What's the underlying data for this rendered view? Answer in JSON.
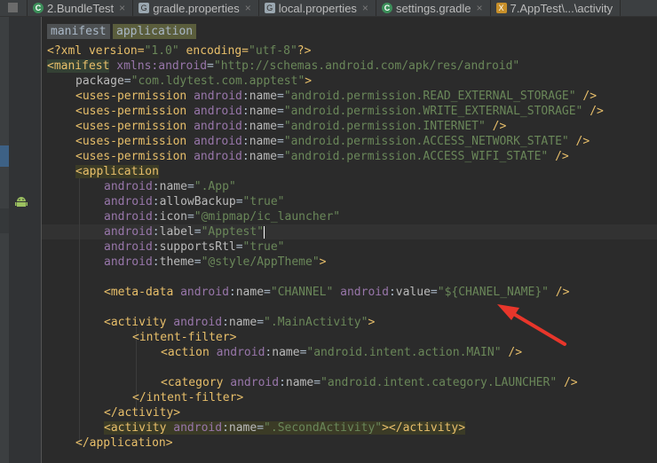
{
  "tabs": [
    {
      "icon": "c-icon",
      "glyph": "C",
      "label": "2.BundleTest",
      "close": "×"
    },
    {
      "icon": "gradle-icon",
      "glyph": "G",
      "label": "gradle.properties",
      "close": "×"
    },
    {
      "icon": "gradle-icon",
      "glyph": "G",
      "label": "local.properties",
      "close": "×"
    },
    {
      "icon": "c-icon",
      "glyph": "C",
      "label": "settings.gradle",
      "close": "×"
    },
    {
      "icon": "xml-icon",
      "glyph": "X",
      "label": "7.AppTest\\...\\activity",
      "close": ""
    }
  ],
  "breadcrumb": [
    "manifest",
    "application"
  ],
  "code": {
    "l1": [
      "<?xml version=",
      "\"1.0\"",
      " encoding=",
      "\"utf-8\"",
      "?>"
    ],
    "l2": [
      "<manifest",
      " xmlns",
      ":",
      "android",
      "=",
      "\"http://schemas.android.com/apk/res/android\""
    ],
    "l3": [
      "package",
      "=",
      "\"com.ldytest.com.apptest\"",
      ">"
    ],
    "perms": [
      "\"android.permission.READ_EXTERNAL_STORAGE\"",
      "\"android.permission.WRITE_EXTERNAL_STORAGE\"",
      "\"android.permission.INTERNET\"",
      "\"android.permission.ACCESS_NETWORK_STATE\"",
      "\"android.permission.ACCESS_WIFI_STATE\""
    ],
    "uses_permission": "<uses-permission",
    "android": "android",
    "colon": ":",
    "name": "name",
    "eq": "=",
    "selfclose": " />",
    "app_open": "<application",
    "app_attrs": [
      [
        "name",
        "\".App\""
      ],
      [
        "allowBackup",
        "\"true\""
      ],
      [
        "icon",
        "\"@mipmap/ic_launcher\""
      ],
      [
        "label",
        "\"Apptest\""
      ],
      [
        "supportsRtl",
        "\"true\""
      ],
      [
        "theme",
        "\"@style/AppTheme\""
      ]
    ],
    "gt": ">",
    "meta": [
      "<meta-data",
      "\"CHANNEL\"",
      "value",
      "\"${CHANEL_NAME}\""
    ],
    "activity_open": "<activity",
    "main_activity": "\".MainActivity\"",
    "intent_filter_open": "<intent-filter>",
    "action": "<action",
    "action_main": "\"android.intent.action.MAIN\"",
    "category": "<category",
    "category_launcher": "\"android.intent.category.LAUNCHER\"",
    "intent_filter_close": "</intent-filter>",
    "activity_close": "</activity>",
    "second_activity": "\".SecondActivity\"",
    "gt_close_activity": "></activity>",
    "app_close": "</application>"
  },
  "colors": {
    "tag": "#e8bf6a",
    "ns": "#9876aa",
    "value": "#6a8759",
    "arrow": "#e8362b"
  }
}
